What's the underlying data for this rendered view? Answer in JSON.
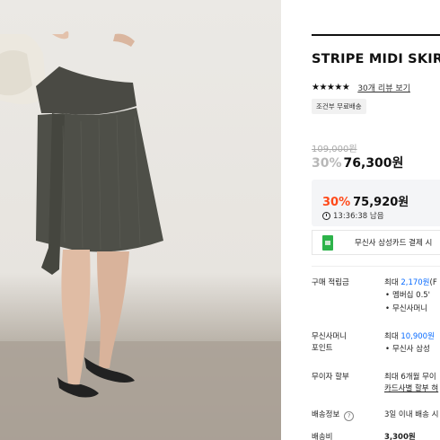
{
  "product": {
    "title": "STRIPE MIDI SKIRT",
    "stars": "★★★★★",
    "review_link": "30개 리뷰 보기",
    "shipping_badge": "조건부 무료배송",
    "original_price": "109,000원",
    "discount_rate": "30%",
    "sale_price": "76,300원"
  },
  "coupon": {
    "discount_rate": "30%",
    "price": "75,920원",
    "timer": "13:36:38 남음"
  },
  "card_banner": {
    "text": "무신사 삼성카드 결제 시"
  },
  "info": {
    "points": {
      "label": "구매 적립금",
      "prefix": "최대 ",
      "amount": "2,170원",
      "suffix": "(F",
      "bullets": [
        "멤버십 0.5'",
        "무신사머니"
      ]
    },
    "money_points": {
      "label_line1": "무신사머니",
      "label_line2": "포인트",
      "prefix": "최대 ",
      "amount": "10,900원",
      "bullets": [
        "무신사 삼성"
      ]
    },
    "installment": {
      "label": "무이자 할부",
      "line1": "최대 6개월 무이",
      "line2": "카드사별 할부 혀"
    },
    "delivery": {
      "label": "배송정보",
      "icon_char": "?",
      "value": "3일 이내 배송 시"
    },
    "shipping_fee": {
      "label": "배송비",
      "value": "3,300원"
    }
  }
}
